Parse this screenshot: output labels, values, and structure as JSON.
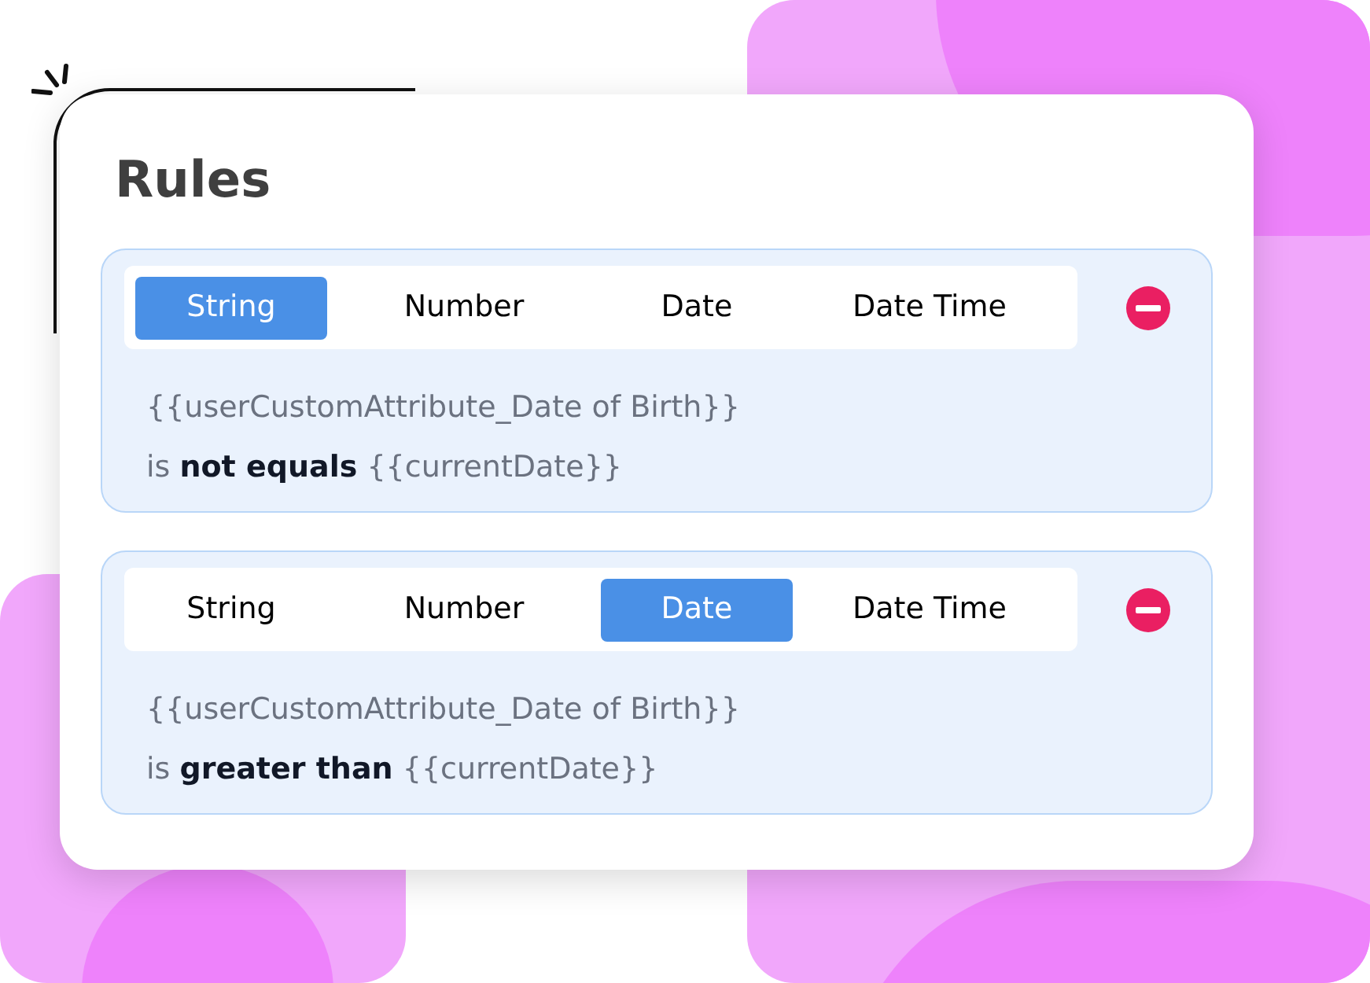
{
  "title": "Rules",
  "rules": [
    {
      "tabs": [
        {
          "label": "String",
          "selected": true
        },
        {
          "label": "Number",
          "selected": false
        },
        {
          "label": "Date",
          "selected": false
        },
        {
          "label": "Date Time",
          "selected": false
        }
      ],
      "attribute": "{{userCustomAttribute_Date of Birth}}",
      "condition": "is **not equals** {{currentDate}}"
    },
    {
      "tabs": [
        {
          "label": "String",
          "selected": false
        },
        {
          "label": "Number",
          "selected": false
        },
        {
          "label": "Date",
          "selected": true
        },
        {
          "label": "Date Time",
          "selected": false
        }
      ],
      "attribute": "{{userCustomAttribute_Date of Birth}}",
      "condition": "is **greater than** {{currentDate}}"
    }
  ]
}
